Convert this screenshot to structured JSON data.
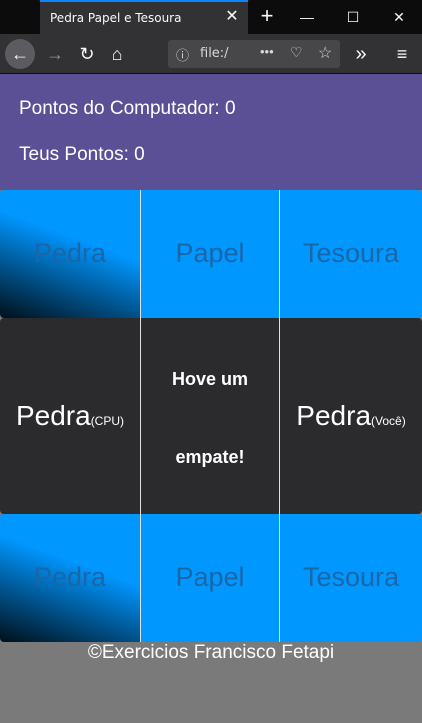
{
  "browser": {
    "tab_title": "Pedra Papel e Tesoura",
    "url": "file:/",
    "new_tab": "+",
    "close": "✕",
    "minimize": "—",
    "maximize": "☐",
    "win_close": "✕"
  },
  "scores": {
    "computer_label": "Pontos do Computador: 0",
    "player_label": "Teus Pontos: 0"
  },
  "top_choices": [
    "Pedra",
    "Papel",
    "Tesoura"
  ],
  "result": {
    "cpu_choice": "Pedra",
    "cpu_tag": "(CPU)",
    "message_line1": "Hove um",
    "message_line2": "empate!",
    "player_choice": "Pedra",
    "player_tag": "(Você)"
  },
  "bottom_choices": [
    "Pedra",
    "Papel",
    "Tesoura"
  ],
  "footer": "©Exercicios Francisco Fetapi",
  "colors": {
    "header": "#5b4f96",
    "choice_row": "#0097ff",
    "result_row": "#2b2b2d",
    "page_bg": "#7a7a7a"
  }
}
